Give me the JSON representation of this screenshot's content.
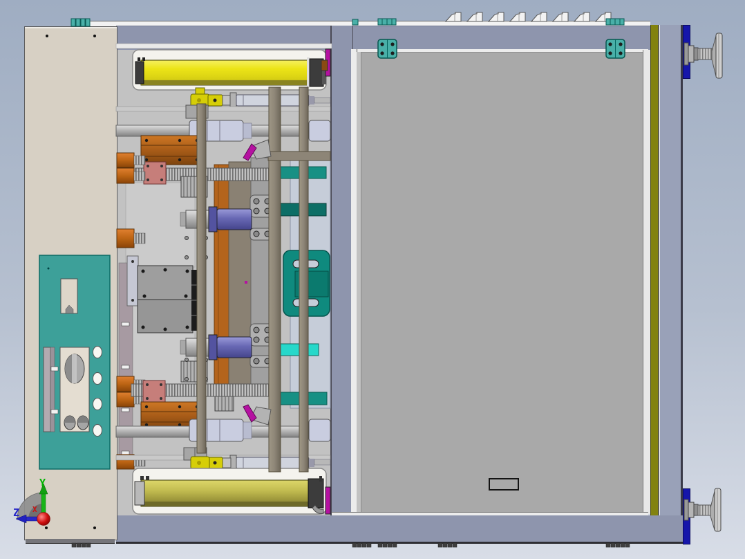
{
  "viewport": {
    "type": "cad-3d-assembly-top-view",
    "triad": {
      "y_label": "Y",
      "z_label": "Z",
      "x_label": "X"
    }
  },
  "door": {
    "label_text": ""
  },
  "colors": {
    "background_top": "#9fadc2",
    "background_mid": "#b6c0d0",
    "background_bottom": "#d8dde7",
    "frame_band": "#8e95ad",
    "door_panel": "#a9a9a9",
    "left_panel": "#d7d0c4",
    "control_panel": "#3da099",
    "machinery_bg": "#c2c2c2",
    "housing": "#f4f3ee",
    "orange_block": "#a85c18",
    "orange_cylinder": "#bc6414",
    "salmon": "#c67e7a",
    "slate": "#6868b4",
    "teal_bar": "#179084",
    "teal_dark": "#0d6e66",
    "teal_bracket": "#0f8a7e",
    "cyan": "#26d8ca",
    "strut": "#8d8577",
    "coupler": "#c9cde0",
    "shaft": "#b0b0b0",
    "magenta": "#b511a1",
    "olive": "#82820e",
    "blue_accent": "#1616aa",
    "right_column": "#99a1b8",
    "hinge": "#49b0a8",
    "wheel": "#cfcfcf",
    "axis_y": "#00b400",
    "axis_z": "#2424c8",
    "axis_x": "#cc1111"
  },
  "parts": [
    {
      "name": "safety-light-curtain-top",
      "color": "#e8e016"
    },
    {
      "name": "safety-light-curtain-bottom",
      "color": "#bcb64a"
    },
    {
      "name": "pneumatic-valve",
      "color": "#d6ce08"
    },
    {
      "name": "ball-screw-flange",
      "color": "#c67e7a"
    },
    {
      "name": "clamp-cylinder",
      "color": "#6868b4"
    },
    {
      "name": "teal-bracket",
      "color": "#0f8a7e"
    },
    {
      "name": "drive-gearbox",
      "color": "#a85c18"
    },
    {
      "name": "door-hinge",
      "color": "#49b0a8"
    },
    {
      "name": "leveling-handwheel",
      "color": "#cfcfcf"
    }
  ]
}
